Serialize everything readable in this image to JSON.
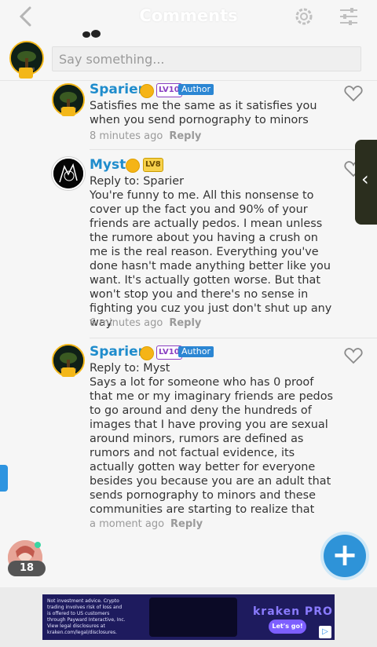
{
  "header": {
    "title": "Comments",
    "back_icon": "chevron-left-icon",
    "settings_icon": "gear-icon",
    "filter_icon": "sliders-icon"
  },
  "composer": {
    "placeholder": "Say something..."
  },
  "comments": [
    {
      "author": "Sparier",
      "level": "LV10",
      "tag": "Author",
      "reply_to": "",
      "text": "Satisfies me the same as it satisfies you when you send pornography to minors",
      "time": "8 minutes ago",
      "reply_label": "Reply"
    },
    {
      "author": "Myst",
      "level": "LV8",
      "tag": "",
      "reply_to": "Reply to: Sparier",
      "text": "You're funny to me. All this nonsense to cover up the fact you and 90% of your friends are actually pedos. I mean unless the rumore about you having a crush on me is the real reason. Everything you've done hasn't made anything better like you want. It's actually gotten worse. But that won't stop you and there's no sense in fighting you cuz you just don't shut up any way",
      "time": "6 minutes ago",
      "reply_label": "Reply"
    },
    {
      "author": "Sparier",
      "level": "LV10",
      "tag": "Author",
      "reply_to": "Reply to: Myst",
      "text": "Says a lot for someone who has 0 proof that me or my imaginary friends are pedos to go around and deny the hundreds of images that I have proving you are sexual around minors, rumors are defined as rumors and not factual evidence, its actually gotten way better for everyone besides you because you are an adult that sends pornography to minors and these communities are starting to realize that",
      "time": "a moment ago",
      "reply_label": "Reply"
    }
  ],
  "online": {
    "count": "18"
  },
  "ad": {
    "disclaimer": "Not investment advice. Crypto trading involves risk of loss and is offered to US customers through Payward Interactive, Inc. View legal disclosures at kraken.com/legal/disclosures.",
    "brand": "kraken PRO",
    "cta": "Let's go!"
  },
  "colors": {
    "accent": "#2e93d8",
    "name_blue": "#1f8ccc",
    "gold": "#f3b718"
  }
}
